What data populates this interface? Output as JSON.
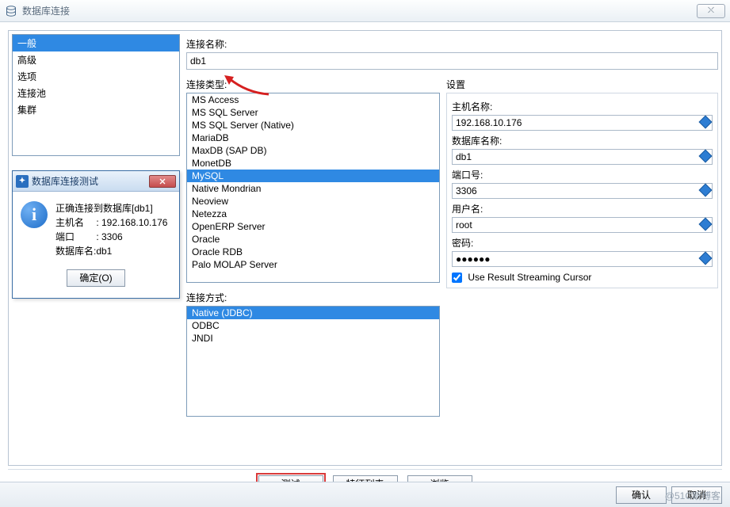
{
  "window": {
    "title": "数据库连接",
    "close_glyph": "⤬"
  },
  "nav": {
    "items": [
      "一般",
      "高级",
      "选项",
      "连接池",
      "集群"
    ],
    "selected_index": 0
  },
  "test_dialog": {
    "title": "数据库连接测试",
    "line1": "正确连接到数据库[db1]",
    "line2": "主机名　 : 192.168.10.176",
    "line3": "端口　　 : 3306",
    "line4": "数据库名:db1",
    "ok_label": "确定(O)"
  },
  "conn_name": {
    "label": "连接名称:",
    "value": "db1"
  },
  "conn_type_label": "连接类型:",
  "conn_types": {
    "items": [
      "MS Access",
      "MS SQL Server",
      "MS SQL Server (Native)",
      "MariaDB",
      "MaxDB (SAP DB)",
      "MonetDB",
      "MySQL",
      "Native Mondrian",
      "Neoview",
      "Netezza",
      "OpenERP Server",
      "Oracle",
      "Oracle RDB",
      "Palo MOLAP Server"
    ],
    "selected_index": 6
  },
  "conn_method_label": "连接方式:",
  "conn_methods": {
    "items": [
      "Native (JDBC)",
      "ODBC",
      "JNDI"
    ],
    "selected_index": 0
  },
  "settings": {
    "title": "设置",
    "host_label": "主机名称:",
    "host_value": "192.168.10.176",
    "db_label": "数据库名称:",
    "db_value": "db1",
    "port_label": "端口号:",
    "port_value": "3306",
    "user_label": "用户名:",
    "user_value": "root",
    "pass_label": "密码:",
    "pass_value": "●●●●●●",
    "cursor_label": "Use Result Streaming Cursor",
    "cursor_checked": true
  },
  "buttons": {
    "test": "测试",
    "features": "特征列表",
    "browse": "浏览"
  },
  "footer": {
    "ok": "确认",
    "cancel": "取消"
  },
  "watermark": "@51C斯博客"
}
